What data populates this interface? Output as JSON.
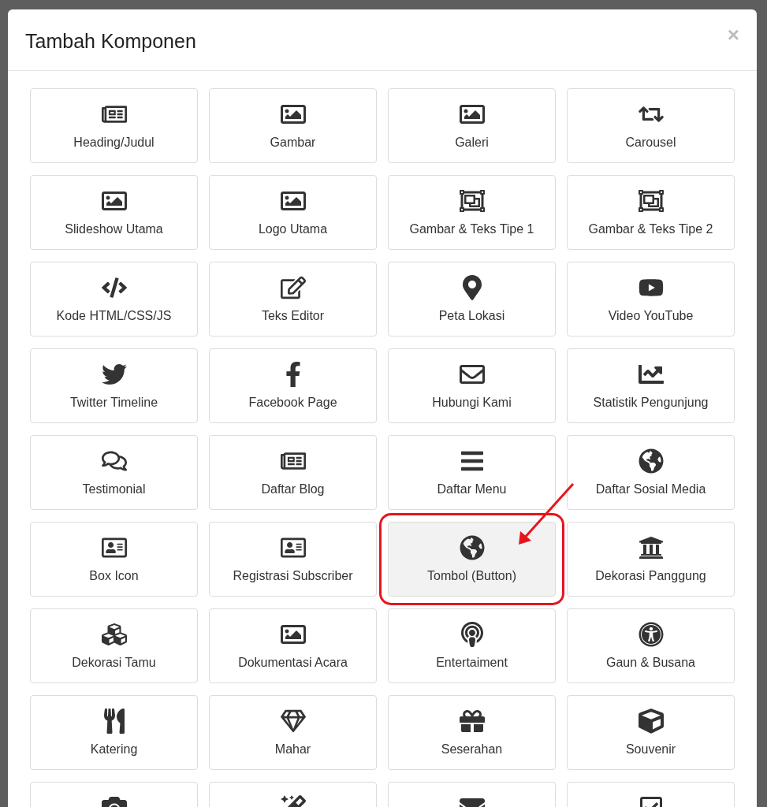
{
  "dialog": {
    "title": "Tambah Komponen",
    "close": "×"
  },
  "components": [
    {
      "label": "Heading/Judul",
      "selected": false
    },
    {
      "label": "Gambar",
      "selected": false
    },
    {
      "label": "Galeri",
      "selected": false
    },
    {
      "label": "Carousel",
      "selected": false
    },
    {
      "label": "Slideshow Utama",
      "selected": false
    },
    {
      "label": "Logo Utama",
      "selected": false
    },
    {
      "label": "Gambar & Teks Tipe 1",
      "selected": false
    },
    {
      "label": "Gambar & Teks Tipe 2",
      "selected": false
    },
    {
      "label": "Kode HTML/CSS/JS",
      "selected": false
    },
    {
      "label": "Teks Editor",
      "selected": false
    },
    {
      "label": "Peta Lokasi",
      "selected": false
    },
    {
      "label": "Video YouTube",
      "selected": false
    },
    {
      "label": "Twitter Timeline",
      "selected": false
    },
    {
      "label": "Facebook Page",
      "selected": false
    },
    {
      "label": "Hubungi Kami",
      "selected": false
    },
    {
      "label": "Statistik Pengunjung",
      "selected": false
    },
    {
      "label": "Testimonial",
      "selected": false
    },
    {
      "label": "Daftar Blog",
      "selected": false
    },
    {
      "label": "Daftar Menu",
      "selected": false
    },
    {
      "label": "Daftar Sosial Media",
      "selected": false
    },
    {
      "label": "Box Icon",
      "selected": false
    },
    {
      "label": "Registrasi Subscriber",
      "selected": false
    },
    {
      "label": "Tombol (Button)",
      "selected": true
    },
    {
      "label": "Dekorasi Panggung",
      "selected": false
    },
    {
      "label": "Dekorasi Tamu",
      "selected": false
    },
    {
      "label": "Dokumentasi Acara",
      "selected": false
    },
    {
      "label": "Entertaiment",
      "selected": false
    },
    {
      "label": "Gaun & Busana",
      "selected": false
    },
    {
      "label": "Katering",
      "selected": false
    },
    {
      "label": "Mahar",
      "selected": false
    },
    {
      "label": "Seserahan",
      "selected": false
    },
    {
      "label": "Souvenir",
      "selected": false
    },
    {
      "selected": false
    },
    {
      "selected": false
    },
    {
      "selected": false
    },
    {
      "selected": false
    }
  ]
}
